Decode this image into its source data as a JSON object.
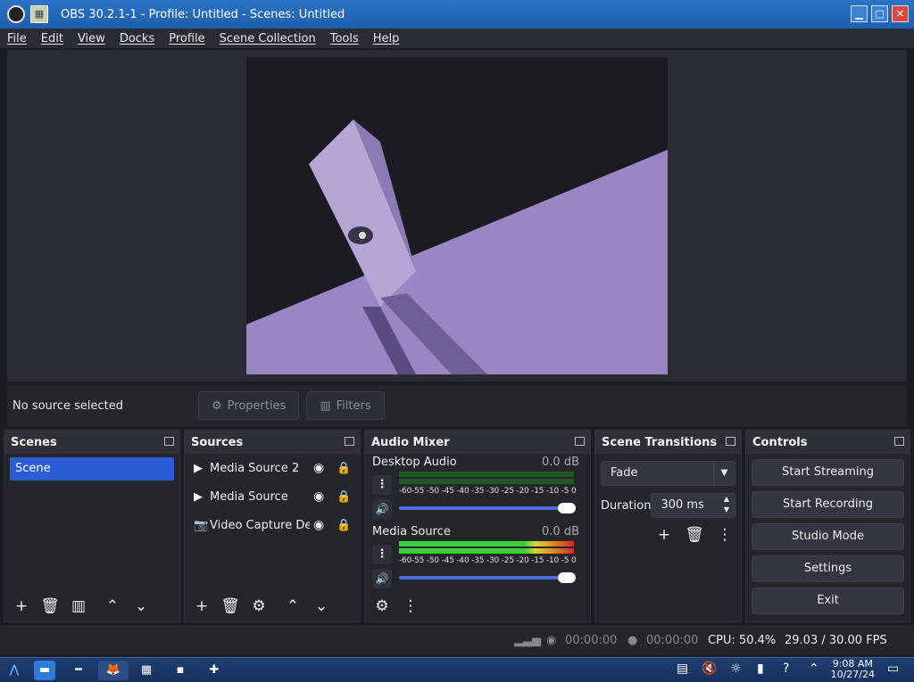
{
  "window": {
    "title": "OBS 30.2.1-1 - Profile: Untitled - Scenes: Untitled",
    "min": "▁",
    "max": "□",
    "close": "✕"
  },
  "menu": [
    "File",
    "Edit",
    "View",
    "Docks",
    "Profile",
    "Scene Collection",
    "Tools",
    "Help"
  ],
  "source_bar": {
    "status": "No source selected",
    "properties": "Properties",
    "filters": "Filters"
  },
  "scenes": {
    "title": "Scenes",
    "items": [
      "Scene"
    ]
  },
  "sources": {
    "title": "Sources",
    "items": [
      {
        "label": "Media Source 2",
        "icon": "play-icon"
      },
      {
        "label": "Media Source",
        "icon": "play-icon"
      },
      {
        "label": "Video Capture Device",
        "icon": "camera-icon"
      }
    ]
  },
  "mixer": {
    "title": "Audio Mixer",
    "channels": [
      {
        "name": "Desktop Audio",
        "db": "0.0 dB",
        "level": 0.0,
        "volume": 1.0
      },
      {
        "name": "Media Source",
        "db": "0.0 dB",
        "level": 1.0,
        "volume": 1.0
      }
    ],
    "scale": "-60-55 -50 -45 -40 -35 -30 -25 -20 -15 -10  -5  0"
  },
  "transitions": {
    "title": "Scene Transitions",
    "selected": "Fade",
    "duration_label": "Duration",
    "duration_value": "300 ms"
  },
  "controls": {
    "title": "Controls",
    "buttons": [
      "Start Streaming",
      "Start Recording",
      "Studio Mode",
      "Settings",
      "Exit"
    ]
  },
  "status": {
    "stream_time": "00:00:00",
    "record_time": "00:00:00",
    "cpu": "CPU: 50.4%",
    "fps": "29.03 / 30.00 FPS"
  },
  "clock": {
    "time": "9:08 AM",
    "date": "10/27/24"
  }
}
